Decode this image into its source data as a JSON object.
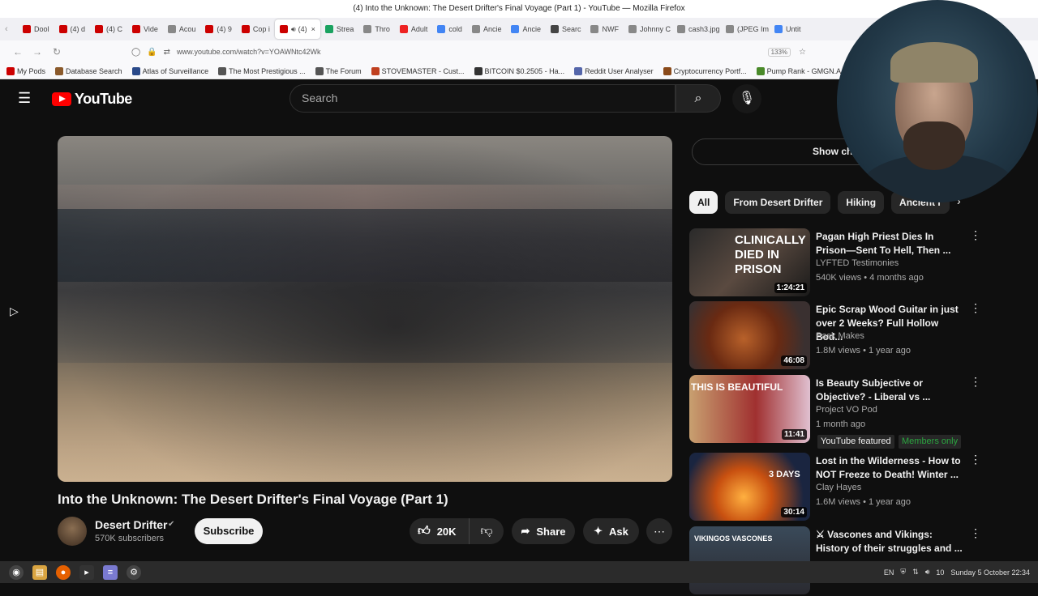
{
  "window": {
    "title": "(4) Into the Unknown: The Desert Drifter's Final Voyage (Part 1) - YouTube — Mozilla Firefox"
  },
  "tabs": [
    {
      "label": "Dool",
      "color": "#cc0000",
      "active": false
    },
    {
      "label": "(4) d",
      "color": "#cc0000",
      "active": false
    },
    {
      "label": "(4) C",
      "color": "#cc0000",
      "active": false
    },
    {
      "label": "Vide",
      "color": "#cc0000",
      "active": false
    },
    {
      "label": "Acou",
      "color": "#888888",
      "active": false
    },
    {
      "label": "(4) 9",
      "color": "#cc0000",
      "active": false
    },
    {
      "label": "Cop i",
      "color": "#cc0000",
      "active": false
    },
    {
      "label": "(4)",
      "color": "#cc0000",
      "active": true
    },
    {
      "label": "Strea",
      "color": "#1aa260",
      "active": false
    },
    {
      "label": "Thro",
      "color": "#888888",
      "active": false
    },
    {
      "label": "Adult",
      "color": "#e22",
      "active": false
    },
    {
      "label": "cold",
      "color": "#4285f4",
      "active": false
    },
    {
      "label": "Ancie",
      "color": "#888888",
      "active": false
    },
    {
      "label": "Ancie",
      "color": "#4285f4",
      "active": false
    },
    {
      "label": "Searc",
      "color": "#444444",
      "active": false
    },
    {
      "label": "NWF",
      "color": "#888888",
      "active": false
    },
    {
      "label": "Johnny C",
      "color": "#888888",
      "active": false
    },
    {
      "label": "cash3.jpg",
      "color": "#888888",
      "active": false
    },
    {
      "label": "(JPEG Im",
      "color": "#888888",
      "active": false
    },
    {
      "label": "Untit",
      "color": "#4285f4",
      "active": false
    }
  ],
  "urlbar": {
    "url": "www.youtube.com/watch?v=YOAWNtc42Wk",
    "zoom": "133%"
  },
  "bookmarks": [
    {
      "label": "My Pods",
      "color": "#cc0000"
    },
    {
      "label": "Database Search",
      "color": "#8b5a2b"
    },
    {
      "label": "Atlas of Surveillance",
      "color": "#2a4a8a"
    },
    {
      "label": "The Most Prestigious ...",
      "color": "#555555"
    },
    {
      "label": "The Forum",
      "color": "#555555"
    },
    {
      "label": "STOVEMASTER - Cust...",
      "color": "#c04020"
    },
    {
      "label": "BITCOIN $0.2505 - Ha...",
      "color": "#333333"
    },
    {
      "label": "Reddit User Analyser",
      "color": "#5566aa"
    },
    {
      "label": "Cryptocurrency Portf...",
      "color": "#8a4a1a"
    },
    {
      "label": "Pump Rank - GMGN.A...",
      "color": "#4a8a2a"
    }
  ],
  "header": {
    "logo_text": "YouTube",
    "search_placeholder": "Search"
  },
  "video": {
    "title": "Into the Unknown: The Desert Drifter's Final Voyage (Part 1)",
    "channel": "Desert Drifter",
    "subscribers": "570K subscribers",
    "subscribe_label": "Subscribe",
    "likes": "20K",
    "share_label": "Share",
    "ask_label": "Ask"
  },
  "sidebar": {
    "chat_replay_label": "Show chat rep",
    "chips": [
      "All",
      "From Desert Drifter",
      "Hiking",
      "Ancient r"
    ],
    "recommendations": [
      {
        "title": "Pagan High Priest Dies In Prison—Sent To Hell, Then ...",
        "channel": "LYFTED Testimonies",
        "meta": "540K views • 4 months ago",
        "duration": "1:24:21",
        "thumb_text": "CLINICALLY DIED IN PRISON"
      },
      {
        "title": "Epic Scrap Wood Guitar in just over 2 Weeks? Full Hollow Bod...",
        "channel": "Pask Makes",
        "meta": "1.8M views • 1 year ago",
        "duration": "46:08",
        "thumb_text": ""
      },
      {
        "title": "Is Beauty Subjective or Objective? - Liberal vs ...",
        "channel": "Project VO Pod",
        "meta": "1 month ago",
        "duration": "11:41",
        "thumb_text": "THIS IS BEAUTIFUL",
        "badges": [
          "YouTube featured",
          "Members only"
        ]
      },
      {
        "title": "Lost in the Wilderness - How to NOT Freeze to Death! Winter ...",
        "channel": "Clay Hayes",
        "meta": "1.6M views • 1 year ago",
        "duration": "30:14",
        "thumb_text": "3 DAYS"
      },
      {
        "title": "⚔ Vascones and Vikings: History of their struggles and ...",
        "channel": "",
        "meta": "",
        "duration": "",
        "thumb_text": "VIKINGOS VASCONES"
      }
    ]
  },
  "taskbar": {
    "lang": "EN",
    "volume": "10",
    "clock": "Sunday  5 October 22:34"
  }
}
